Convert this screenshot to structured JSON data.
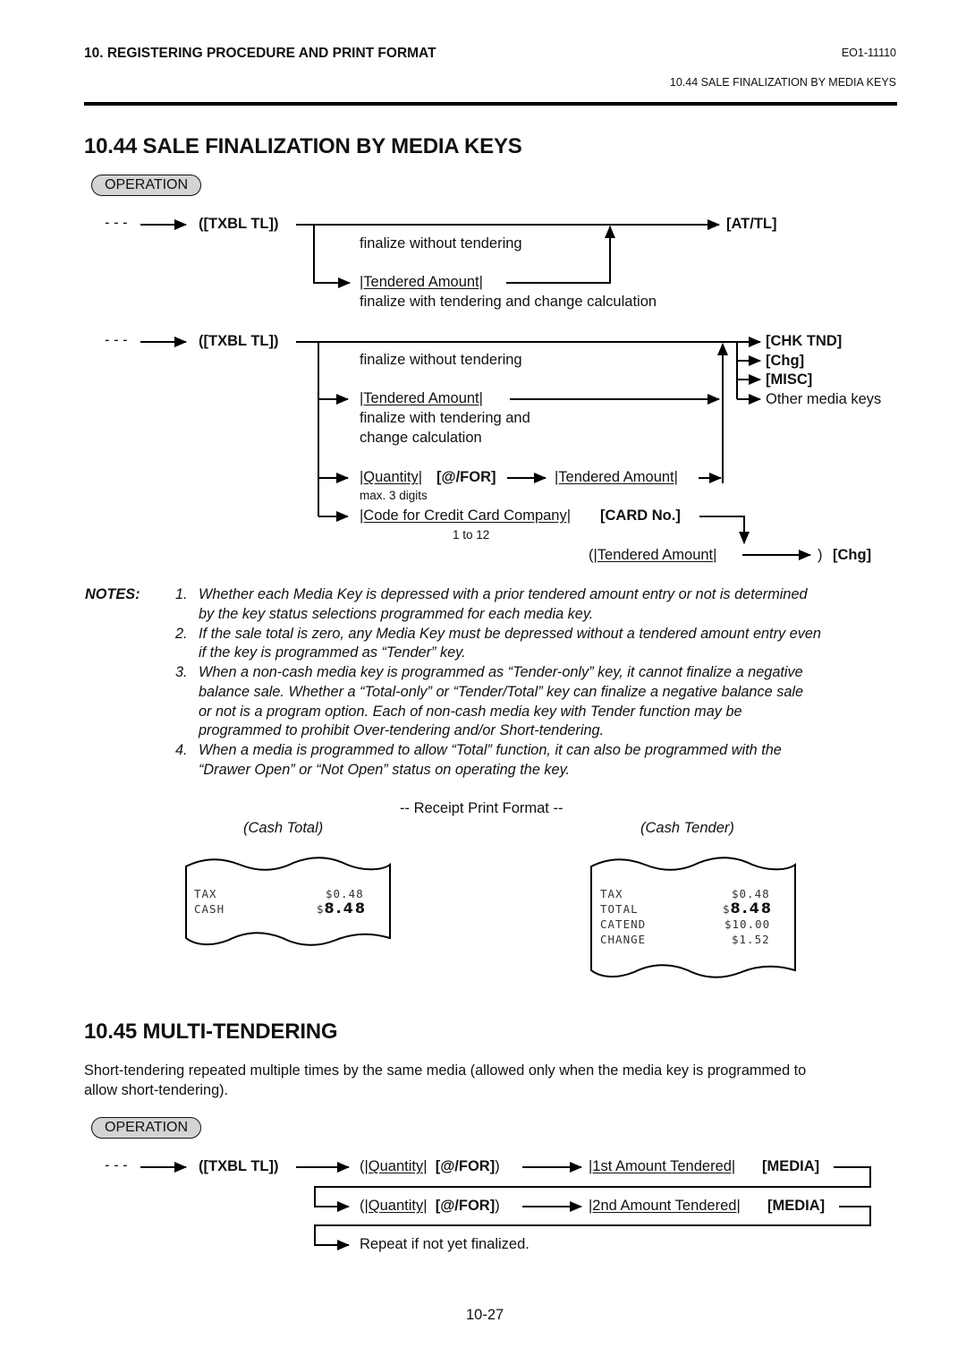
{
  "header": {
    "chapter": "10. REGISTERING PROCEDURE AND PRINT FORMAT",
    "doc_code": "EO1-11110",
    "section_ref": "10.44  SALE FINALIZATION BY MEDIA KEYS"
  },
  "section_1044": {
    "title": "10.44  SALE FINALIZATION BY MEDIA KEYS",
    "operation_label": "OPERATION",
    "flow1": {
      "lead": "- - -",
      "start_key": "([TXBL TL])",
      "note_no_tender": "finalize without tendering",
      "tendered_amount": "|Tendered Amount|",
      "note_with_tender": "finalize with tendering and change calculation",
      "end_key": "[AT/TL]"
    },
    "flow2": {
      "lead": "- - -",
      "start_key": "([TXBL TL])",
      "note_no_tender": "finalize without tendering",
      "tendered_amount": "|Tendered Amount|",
      "note_with_tender_line1": "finalize with tendering and",
      "note_with_tender_line2": "change calculation",
      "quantity": "|Quantity|",
      "for_key": "[@/FOR]",
      "tendered_amount_2": "|Tendered Amount|",
      "max_digits": "max. 3 digits",
      "credit_code": "|Code for Credit Card Company|",
      "card_key": "[CARD No.]",
      "credit_range": "1 to 12",
      "paren_open_tendered": "(|Tendered Amount|",
      "paren_close": ")",
      "chg_key_final": "[Chg]",
      "end_keys": [
        "[CHK TND]",
        "[Chg]",
        "[MISC]",
        "Other media keys"
      ]
    },
    "notes_label": "NOTES:",
    "notes": [
      {
        "num": "1.",
        "lines": [
          "Whether each Media Key is depressed with a prior tendered amount entry or not is determined",
          "by the key status selections programmed for each media key."
        ]
      },
      {
        "num": "2.",
        "lines": [
          "If the sale total is zero, any Media Key must be depressed without a tendered amount entry even",
          "if the key is programmed as “Tender” key."
        ]
      },
      {
        "num": "3.",
        "lines": [
          "When a non-cash media key is programmed as “Tender-only” key, it cannot finalize a negative",
          "balance sale.   Whether a “Total-only” or “Tender/Total” key can finalize a negative balance sale",
          "or not is a program option.   Each of non-cash media key with Tender function may be",
          "programmed to prohibit Over-tendering and/or Short-tendering."
        ]
      },
      {
        "num": "4.",
        "lines": [
          "When a media is programmed to allow “Total” function, it can also be programmed with the",
          "“Drawer Open” or “Not Open” status on operating the key."
        ]
      }
    ],
    "receipt_format_title": "-- Receipt Print Format --",
    "receipts": [
      {
        "caption": "(Cash Total)",
        "rows": [
          {
            "label": "TAX",
            "currency": "$",
            "value": "0.48",
            "big": false
          },
          {
            "label": "CASH",
            "currency": "$",
            "value": "8.48",
            "big": true
          }
        ]
      },
      {
        "caption": "(Cash Tender)",
        "rows": [
          {
            "label": "TAX",
            "currency": "$",
            "value": "0.48",
            "big": false
          },
          {
            "label": "TOTAL",
            "currency": "$",
            "value": "8.48",
            "big": true
          },
          {
            "label": "CATEND",
            "currency": "$",
            "value": "10.00",
            "big": false
          },
          {
            "label": "CHANGE",
            "currency": "$",
            "value": "1.52",
            "big": false
          }
        ]
      }
    ]
  },
  "section_1045": {
    "title": "10.45  MULTI-TENDERING",
    "description_line1": "Short-tendering repeated multiple times by the same media (allowed only when the media key is programmed to",
    "description_line2": "allow short-tendering).",
    "operation_label": "OPERATION",
    "flow": {
      "lead": "- - -",
      "start_key": "([TXBL TL])",
      "row1_paren_open": "(",
      "row1_quantity": "|Quantity|",
      "row1_for": "[@/FOR]",
      "row1_paren_close": ")",
      "row1_amount": "|1st Amount Tendered|",
      "row1_media": "[MEDIA]",
      "row2_paren_open": "(",
      "row2_quantity": "|Quantity|",
      "row2_for": "[@/FOR]",
      "row2_paren_close": ")",
      "row2_amount": "|2nd Amount Tendered|",
      "row2_media": "[MEDIA]",
      "row3_text": "Repeat if not yet finalized."
    }
  },
  "footer": {
    "page_number": "10-27"
  }
}
